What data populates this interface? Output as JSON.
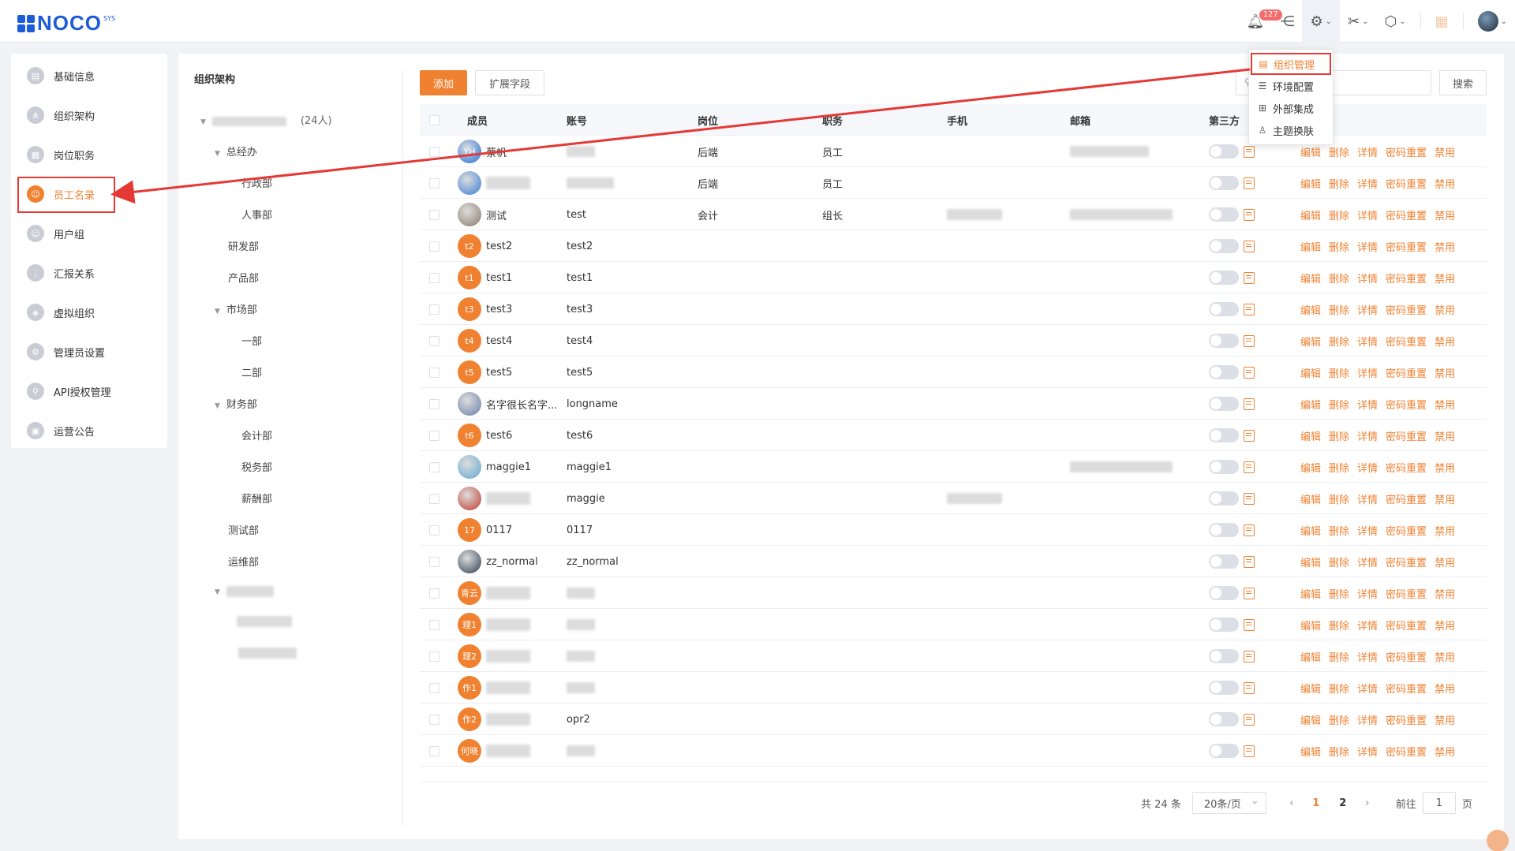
{
  "app": {
    "logo_text": "NOCO",
    "logo_sup": "SYS",
    "notification_count": "127"
  },
  "settings_menu": [
    {
      "label": "组织管理",
      "icon": "org-icon"
    },
    {
      "label": "环境配置",
      "icon": "config-icon"
    },
    {
      "label": "外部集成",
      "icon": "integration-icon"
    },
    {
      "label": "主题换肤",
      "icon": "theme-icon"
    }
  ],
  "sidebar": {
    "items": [
      {
        "label": "基础信息",
        "icon": "info-icon"
      },
      {
        "label": "组织架构",
        "icon": "org-chart-icon"
      },
      {
        "label": "岗位职务",
        "icon": "position-icon"
      },
      {
        "label": "员工名录",
        "icon": "employee-icon",
        "active": true
      },
      {
        "label": "用户组",
        "icon": "user-group-icon"
      },
      {
        "label": "汇报关系",
        "icon": "report-icon"
      },
      {
        "label": "虚拟组织",
        "icon": "virtual-org-icon"
      },
      {
        "label": "管理员设置",
        "icon": "admin-icon"
      },
      {
        "label": "API授权管理",
        "icon": "api-icon"
      },
      {
        "label": "运营公告",
        "icon": "announcement-icon"
      }
    ]
  },
  "org_tree": {
    "title": "组织架构",
    "root_count": "(24人)",
    "nodes": [
      {
        "label": "总经办",
        "level": 1,
        "expanded": true
      },
      {
        "label": "行政部",
        "level": 2
      },
      {
        "label": "人事部",
        "level": 2
      },
      {
        "label": "研发部",
        "level": 1
      },
      {
        "label": "产品部",
        "level": 1
      },
      {
        "label": "市场部",
        "level": 1,
        "expanded": true
      },
      {
        "label": "一部",
        "level": 2
      },
      {
        "label": "二部",
        "level": 2
      },
      {
        "label": "财务部",
        "level": 1,
        "expanded": true
      },
      {
        "label": "会计部",
        "level": 2
      },
      {
        "label": "税务部",
        "level": 2
      },
      {
        "label": "薪酬部",
        "level": 2
      },
      {
        "label": "测试部",
        "level": 1
      },
      {
        "label": "运维部",
        "level": 1
      }
    ]
  },
  "toolbar": {
    "add_label": "添加",
    "extend_label": "扩展字段",
    "search_label": "搜索"
  },
  "table": {
    "columns": [
      "成员",
      "账号",
      "岗位",
      "职务",
      "手机",
      "邮箱",
      "第三方"
    ],
    "actions": [
      "编辑",
      "删除",
      "详情",
      "密码重置",
      "禁用"
    ],
    "rows": [
      {
        "avatar": "YH",
        "name": "蔡帆",
        "account": "",
        "post": "后端",
        "duty": "员工",
        "avatar_color": "#1e6fd9"
      },
      {
        "avatar": "",
        "name": "",
        "account": "",
        "post": "后端",
        "duty": "员工",
        "avatar_color": "#3a7bd5"
      },
      {
        "avatar": "",
        "name": "测试",
        "account": "test",
        "post": "会计",
        "duty": "组长",
        "avatar_color": "#8a7a6a"
      },
      {
        "avatar": "t2",
        "name": "test2",
        "account": "test2",
        "post": "",
        "duty": ""
      },
      {
        "avatar": "t1",
        "name": "test1",
        "account": "test1",
        "post": "",
        "duty": ""
      },
      {
        "avatar": "t3",
        "name": "test3",
        "account": "test3",
        "post": "",
        "duty": ""
      },
      {
        "avatar": "t4",
        "name": "test4",
        "account": "test4",
        "post": "",
        "duty": ""
      },
      {
        "avatar": "t5",
        "name": "test5",
        "account": "test5",
        "post": "",
        "duty": ""
      },
      {
        "avatar": "",
        "name": "名字很长名字...",
        "account": "longname",
        "post": "",
        "duty": "",
        "avatar_color": "#6a7fa8"
      },
      {
        "avatar": "t6",
        "name": "test6",
        "account": "test6",
        "post": "",
        "duty": ""
      },
      {
        "avatar": "",
        "name": "maggie1",
        "account": "maggie1",
        "post": "",
        "duty": "",
        "avatar_color": "#5fa8d3"
      },
      {
        "avatar": "",
        "name": "",
        "account": "maggie",
        "post": "",
        "duty": "",
        "avatar_color": "#c0392b"
      },
      {
        "avatar": "17",
        "name": "0117",
        "account": "0117",
        "post": "",
        "duty": ""
      },
      {
        "avatar": "",
        "name": "zz_normal",
        "account": "zz_normal",
        "post": "",
        "duty": "",
        "avatar_color": "#2c3e50"
      },
      {
        "avatar": "青云",
        "name": "",
        "account": "",
        "post": "",
        "duty": ""
      },
      {
        "avatar": "理1",
        "name": "",
        "account": "",
        "post": "",
        "duty": ""
      },
      {
        "avatar": "理2",
        "name": "",
        "account": "",
        "post": "",
        "duty": ""
      },
      {
        "avatar": "作1",
        "name": "",
        "account": "",
        "post": "",
        "duty": ""
      },
      {
        "avatar": "作2",
        "name": "",
        "account": "opr2",
        "post": "",
        "duty": ""
      },
      {
        "avatar": "何晓",
        "name": "",
        "account": "",
        "post": "",
        "duty": ""
      }
    ]
  },
  "pagination": {
    "total": "共 24 条",
    "page_size": "20条/页",
    "pages": [
      "1",
      "2"
    ],
    "current": "1",
    "goto_label": "前往",
    "goto_value": "1",
    "page_suffix": "页"
  },
  "colors": {
    "accent": "#f08131",
    "highlight_box": "#e53935",
    "brand": "#1e5bd6"
  }
}
